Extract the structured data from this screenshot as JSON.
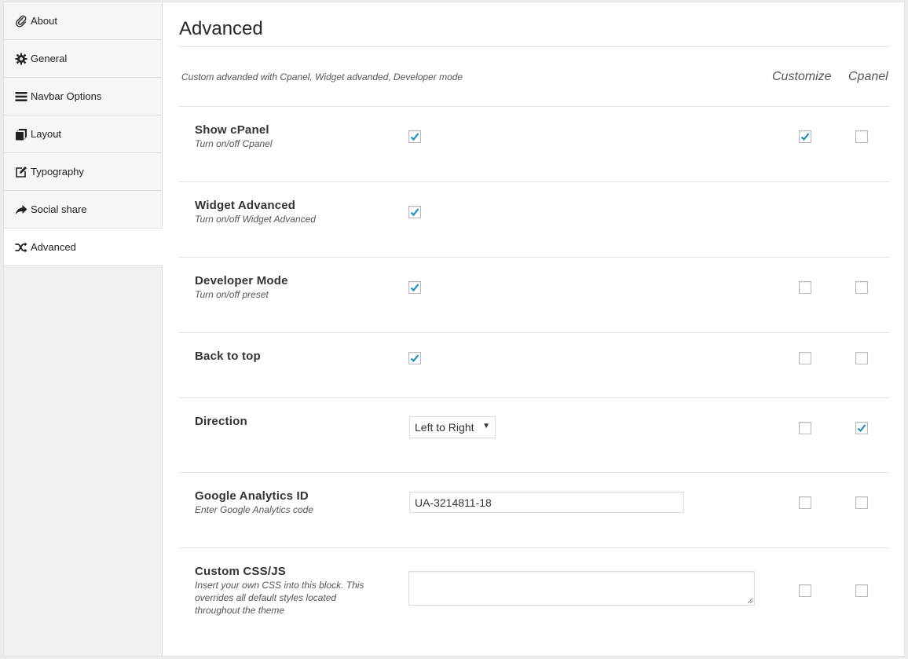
{
  "sidebar": {
    "items": [
      {
        "label": "About",
        "icon": "paperclip-icon"
      },
      {
        "label": "General",
        "icon": "gear-icon"
      },
      {
        "label": "Navbar Options",
        "icon": "bars-icon"
      },
      {
        "label": "Layout",
        "icon": "copy-icon"
      },
      {
        "label": "Typography",
        "icon": "edit-icon"
      },
      {
        "label": "Social share",
        "icon": "share-icon"
      },
      {
        "label": "Advanced",
        "icon": "random-icon",
        "active": true
      }
    ]
  },
  "main": {
    "title": "Advanced",
    "intro": "Custom advanded with Cpanel, Widget advanded, Developer mode",
    "col_customize": "Customize",
    "col_cpanel": "Cpanel"
  },
  "rows": {
    "show_cpanel": {
      "title": "Show cPanel",
      "desc": "Turn on/off Cpanel",
      "main_checked": true,
      "customize_checked": true,
      "cpanel_checked": false
    },
    "widget_advanced": {
      "title": "Widget Advanced",
      "desc": "Turn on/off Widget Advanced",
      "main_checked": true
    },
    "developer_mode": {
      "title": "Developer Mode",
      "desc": "Turn on/off preset",
      "main_checked": true,
      "customize_checked": false,
      "cpanel_checked": false
    },
    "back_to_top": {
      "title": "Back to top",
      "main_checked": true,
      "customize_checked": false,
      "cpanel_checked": false
    },
    "direction": {
      "title": "Direction",
      "selected": "Left to Right",
      "customize_checked": false,
      "cpanel_checked": true
    },
    "google_analytics": {
      "title": "Google Analytics ID",
      "desc": "Enter Google Analytics code",
      "value": "UA-3214811-18",
      "customize_checked": false,
      "cpanel_checked": false
    },
    "custom_css": {
      "title": "Custom CSS/JS",
      "desc": "Insert your own CSS into this block. This overrides all default styles located throughout the theme",
      "value": "",
      "customize_checked": false,
      "cpanel_checked": false
    }
  },
  "colors": {
    "accent": "#1e8cbe",
    "sidebar_bg": "#f1f1f1",
    "border": "#e1e1e1"
  }
}
